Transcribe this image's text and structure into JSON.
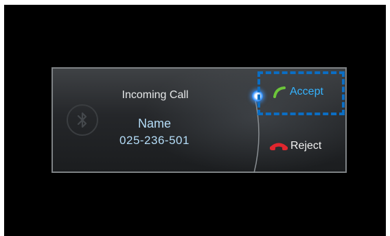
{
  "call": {
    "title": "Incoming Call",
    "caller_name": "Name",
    "caller_number": "025-236-501"
  },
  "actions": {
    "accept_label": "Accept",
    "reject_label": "Reject"
  },
  "icons": {
    "bluetooth": "bluetooth-icon",
    "accept": "phone-handset-green-icon",
    "reject": "phone-handset-red-icon",
    "focus": "focus-cursor-icon"
  },
  "colors": {
    "accept_text": "#34b3ff",
    "accept_handset": "#6cc63a",
    "reject_handset": "#e0262e",
    "focus_outline": "#0b6ec4",
    "caller_text": "#b5ddf8"
  }
}
